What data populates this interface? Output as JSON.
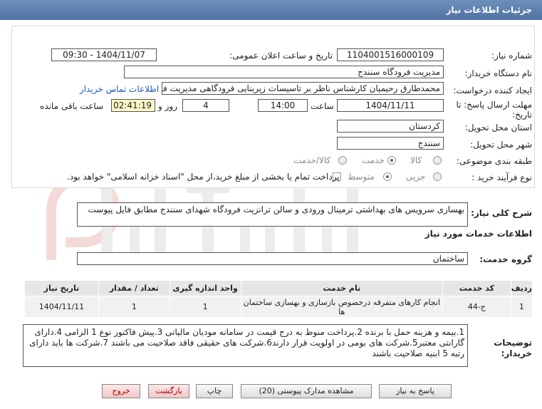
{
  "header": {
    "title": "جزئیات اطلاعات نیاز"
  },
  "need_number": {
    "label": "شماره نیاز:",
    "value": "1104001516000109"
  },
  "announce": {
    "label": "تاریخ و ساعت اعلان عمومی:",
    "value": "1404/11/07 - 09:30"
  },
  "buyer_org": {
    "label": "نام دستگاه خریدار:",
    "value": "مدیریت فرودگاه سنندج"
  },
  "creator": {
    "label": "ایجاد کننده درخواست:",
    "value": "محمدطارق رحیمیان کارشناس ناظر بر تاسیسات زیربنایی فرودگاهی مدیریت فرودگاه سنندج",
    "contact_link": "اطلاعات تماس خریدار"
  },
  "deadline": {
    "label1": "مهلت ارسال پاسخ: تا",
    "label2": "تاریخ:",
    "date": "1404/11/11",
    "time_label": "ساعت",
    "time": "14:00",
    "days": "4",
    "days_label": "روز و",
    "remaining": "02:41:19",
    "remaining_label": "ساعت باقی مانده"
  },
  "province": {
    "label": "استان محل تحویل:",
    "value": "کردستان"
  },
  "city": {
    "label": "شهر محل تحویل:",
    "value": "سنندج"
  },
  "category": {
    "label": "طبقه بندی موضوعی:",
    "options": [
      "کالا",
      "خدمت",
      "کالا/خدمت"
    ]
  },
  "purchase": {
    "label": "نوع فرآیند خرید :",
    "options": [
      "جزیی",
      "متوسط"
    ],
    "note": "پرداخت تمام یا بخشی از مبلغ خرید،از محل \"اسناد خزانه اسلامی\" خواهد بود."
  },
  "summary": {
    "label": "شرح کلی نیاز:",
    "value": "بهسازی سرویس های بهداشتی ترمینال ورودی و سالن ترانزیت فرودگاه شهدای سنندج  مطابق فایل پیوست"
  },
  "services_title": "اطلاعات خدمات مورد نیاز",
  "service_group": {
    "label": "گروه خدمت:",
    "value": "ساختمان"
  },
  "table": {
    "headers": [
      "ردیف",
      "کد خدمت",
      "نام خدمت",
      "واحد اندازه گیری",
      "تعداد / مقدار",
      "تاریخ نیاز"
    ],
    "rows": [
      [
        "1",
        "ج-44",
        "انجام کارهای متفرقه درخصوص بازسازی و بهسازی ساختمان ها",
        "1",
        "1",
        "1404/11/11"
      ]
    ]
  },
  "buyer_notes": {
    "label1": "توضیحات",
    "label2": "خریدار:",
    "value": "1.بیمه و هزینه حمل با برنده 2.پرداخت منوط به درج قیمت در سامانه مودیان مالیاتی 3.پیش فاکتور نوع 1 الزامی 4.دارای گارانتی معتبر5.شرکت های بومی در اولویت قرار دارند6.شرکت های حقیقی فاقد صلاحیت می باشند 7.شرکت ها باید دارای رتبه 5 ابنیه صلاحیت باشند"
  },
  "buttons": {
    "reply": "پاسخ به نیاز",
    "docs": "مشاهده مدارک پیوستی (20)",
    "print": "چاپ",
    "back": "بازگشت",
    "exit": "خروج"
  },
  "colors": {
    "header": "#5a7cab",
    "link": "#1e5bb5",
    "exit": "#a00000"
  }
}
